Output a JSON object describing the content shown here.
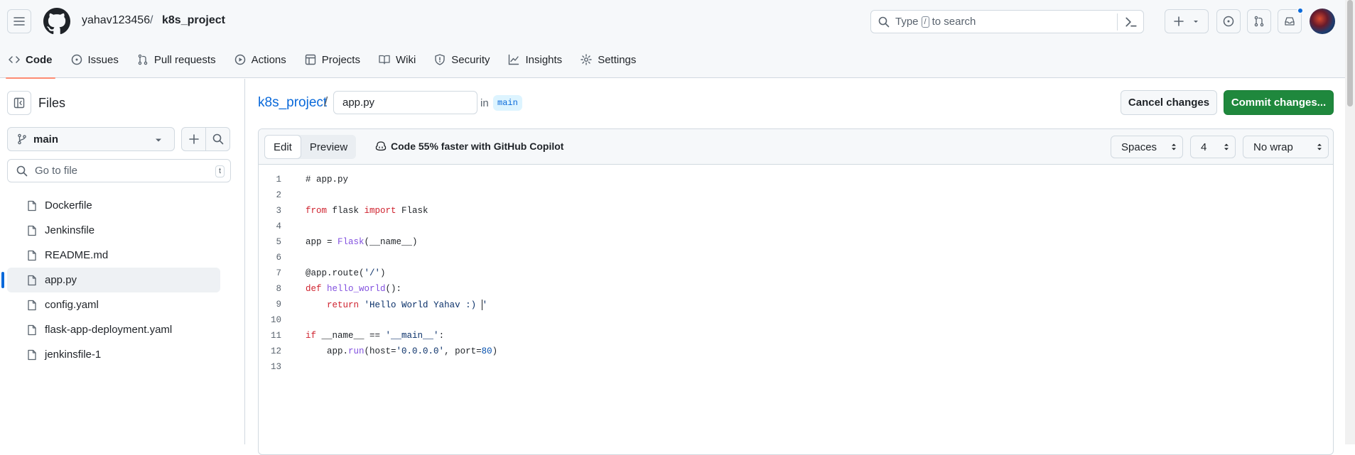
{
  "header": {
    "owner": "yahav123456",
    "separator": "/",
    "repo": "k8s_project",
    "search_prefix": "Type",
    "search_key": "/",
    "search_suffix": "to search"
  },
  "tabs": [
    {
      "label": "Code",
      "icon": "code-icon",
      "active": true
    },
    {
      "label": "Issues",
      "icon": "issue-icon"
    },
    {
      "label": "Pull requests",
      "icon": "git-pull-request-icon"
    },
    {
      "label": "Actions",
      "icon": "play-icon"
    },
    {
      "label": "Projects",
      "icon": "table-icon"
    },
    {
      "label": "Wiki",
      "icon": "book-icon"
    },
    {
      "label": "Security",
      "icon": "shield-icon"
    },
    {
      "label": "Insights",
      "icon": "graph-icon"
    },
    {
      "label": "Settings",
      "icon": "gear-icon"
    }
  ],
  "sidebar": {
    "title": "Files",
    "branch": "main",
    "goto_placeholder": "Go to file",
    "goto_hint": "t",
    "files": [
      {
        "name": "Dockerfile"
      },
      {
        "name": "Jenkinsfile"
      },
      {
        "name": "README.md"
      },
      {
        "name": "app.py",
        "active": true
      },
      {
        "name": "config.yaml"
      },
      {
        "name": "flask-app-deployment.yaml"
      },
      {
        "name": "jenkinsfile-1"
      }
    ]
  },
  "editor": {
    "repo_link": "k8s_project",
    "path_sep": "/",
    "filename": "app.py",
    "in_label": "in",
    "branch": "main",
    "cancel_label": "Cancel changes",
    "commit_label": "Commit changes...",
    "edit_tab": "Edit",
    "preview_tab": "Preview",
    "copilot_text": "Code 55% faster with GitHub Copilot",
    "indent_mode": "Spaces",
    "indent_size": "4",
    "wrap_mode": "No wrap",
    "lines": [
      {
        "n": "1",
        "tokens": [
          {
            "t": "# app.py",
            "c": "plain"
          }
        ]
      },
      {
        "n": "2",
        "tokens": []
      },
      {
        "n": "3",
        "tokens": [
          {
            "t": "from",
            "c": "kw"
          },
          {
            "t": " flask ",
            "c": "plain"
          },
          {
            "t": "import",
            "c": "kw"
          },
          {
            "t": " Flask",
            "c": "plain"
          }
        ]
      },
      {
        "n": "4",
        "tokens": []
      },
      {
        "n": "5",
        "tokens": [
          {
            "t": "app = ",
            "c": "plain"
          },
          {
            "t": "Flask",
            "c": "fn"
          },
          {
            "t": "(__name__)",
            "c": "plain"
          }
        ]
      },
      {
        "n": "6",
        "tokens": []
      },
      {
        "n": "7",
        "tokens": [
          {
            "t": "@app.route(",
            "c": "plain"
          },
          {
            "t": "'/'",
            "c": "str"
          },
          {
            "t": ")",
            "c": "plain"
          }
        ]
      },
      {
        "n": "8",
        "tokens": [
          {
            "t": "def",
            "c": "kw"
          },
          {
            "t": " ",
            "c": "plain"
          },
          {
            "t": "hello_world",
            "c": "fn"
          },
          {
            "t": "():",
            "c": "plain"
          }
        ]
      },
      {
        "n": "9",
        "tokens": [
          {
            "t": "    ",
            "c": "plain"
          },
          {
            "t": "return",
            "c": "kw"
          },
          {
            "t": " ",
            "c": "plain"
          },
          {
            "t": "'Hello World Yahav :) ",
            "c": "str"
          },
          {
            "t": "",
            "c": "caret"
          },
          {
            "t": "'",
            "c": "str"
          }
        ]
      },
      {
        "n": "10",
        "tokens": []
      },
      {
        "n": "11",
        "tokens": [
          {
            "t": "if",
            "c": "kw"
          },
          {
            "t": " __name__ == ",
            "c": "plain"
          },
          {
            "t": "'__main__'",
            "c": "str"
          },
          {
            "t": ":",
            "c": "plain"
          }
        ]
      },
      {
        "n": "12",
        "tokens": [
          {
            "t": "    app.",
            "c": "plain"
          },
          {
            "t": "run",
            "c": "fn"
          },
          {
            "t": "(host=",
            "c": "plain"
          },
          {
            "t": "'0.0.0.0'",
            "c": "str"
          },
          {
            "t": ", port=",
            "c": "plain"
          },
          {
            "t": "80",
            "c": "num"
          },
          {
            "t": ")",
            "c": "plain"
          }
        ]
      },
      {
        "n": "13",
        "tokens": []
      }
    ]
  }
}
